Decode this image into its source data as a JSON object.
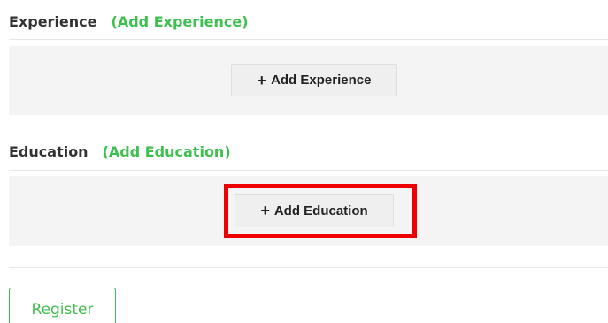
{
  "experience": {
    "title": "Experience",
    "header_link": "(Add Experience)",
    "button_icon": "plus-icon",
    "button_label": "Add Experience"
  },
  "education": {
    "title": "Education",
    "header_link": "(Add Education)",
    "button_icon": "plus-icon",
    "button_label": "Add Education"
  },
  "register_label": "Register",
  "colors": {
    "accent": "#3fbf4f",
    "highlight": "#ee0000",
    "panel_bg": "#f4f4f4"
  }
}
